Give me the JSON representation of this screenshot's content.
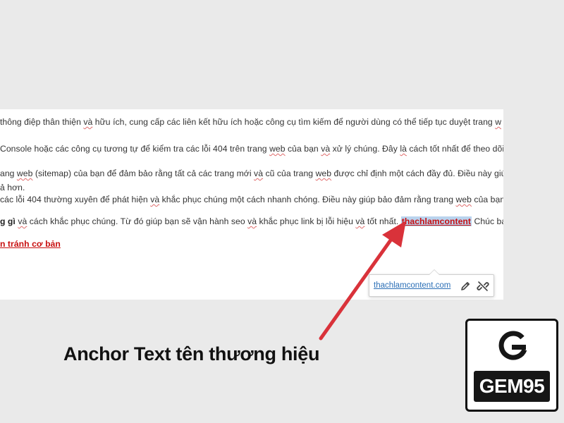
{
  "editor": {
    "line1": {
      "a": " thông điệp thân thiện ",
      "b": "và",
      "c": " hữu ích, cung cấp các liên kết hữu ích hoặc công cụ tìm kiếm để người dùng có thể tiếp tục duyệt trang ",
      "d": "w"
    },
    "line2": {
      "a": "Console hoặc các công cụ tương tự để kiểm tra các lỗi 404 trên trang ",
      "b": "web",
      "c": " của bạn ",
      "d": "và",
      "e": " xử lý chúng. Đây ",
      "f": "là",
      "g": " cách tốt nhất để theo dõi"
    },
    "line3": {
      "a": "ang ",
      "b": "web",
      "c": " (sitemap) của bạn để đảm bảo rằng tất cả các trang mới ",
      "d": "và",
      "e": " cũ của trang ",
      "f": "web",
      "g": " được chỉ định một cách đầy đủ. Điều này giú"
    },
    "line4": {
      "a": "ả hơn."
    },
    "line5": {
      "a": "các lỗi 404 thường xuyên để phát hiện ",
      "b": "và",
      "c": " khắc phục chúng một cách nhanh chóng. Điều này giúp bảo đảm rằng trang ",
      "d": "web",
      "e": " của bạn"
    },
    "line6": {
      "a": "g gì",
      "b": " ",
      "c": "và",
      "d": " cách khắc phục chúng. Từ đó giúp bạn sẽ vận hành seo ",
      "e": "và",
      "f": " khắc phục link bị lỗi hiệu ",
      "g": "và",
      "h": " tốt nhất. ",
      "anchor": "thachlamcontent",
      "i": " Chúc bạn"
    },
    "line7": {
      "a": "n tránh cơ bản"
    }
  },
  "link_popup": {
    "url": "thachlamcontent.com",
    "edit_icon": "pencil-icon",
    "unlink_icon": "unlink-icon"
  },
  "caption": "Anchor Text tên thương hiệu",
  "logo": {
    "text": "GEM95"
  },
  "colors": {
    "arrow": "#d9323a",
    "anchor_bg": "#b9d3ee",
    "anchor_text": "#c81010",
    "link_blue": "#2b6fb6",
    "page_bg": "#eaeaea"
  }
}
